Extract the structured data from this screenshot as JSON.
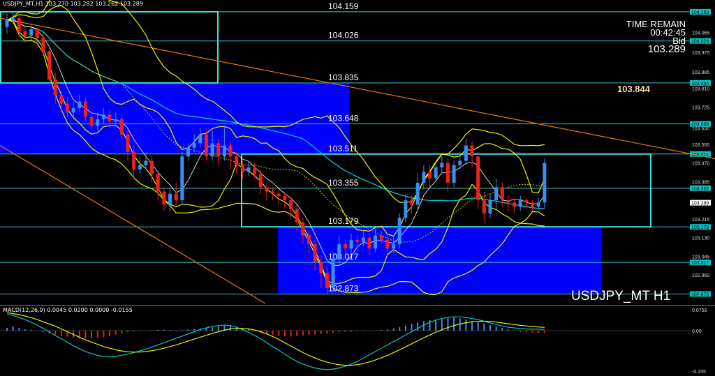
{
  "header": {
    "main_title": "USDJPY_MT,H1  103.270 103.282 103.262 103.289",
    "macd_title": "MACD(12,26,9) 0.0045 0.0200 0.0000 -0.0155"
  },
  "info": {
    "time_label": "TIME REMAIN",
    "time_value": "00:42:45",
    "bid_label": "Bid",
    "bid_value": "103.289"
  },
  "big_price": "103.844",
  "symbol_watermark": "USDJPY_MT H1",
  "colors": {
    "background": "#000000",
    "bull_candle": "#3a8df5",
    "bear_candle": "#f01e1e",
    "zone_fill": "#0000ff",
    "level_line": "#38c8c8",
    "box_outline": "#40e0e0",
    "bollinger": "#f0f000",
    "trendline": "#f07800",
    "ma_cyan": "#00c8c8",
    "ma_green": "#2e8b2e",
    "price_tag_bg": "#00c8c8",
    "current_tag_bg": "#ffffff"
  },
  "chart_data": {
    "type": "candlestick",
    "symbol": "USDJPY_MT",
    "timeframe": "H1",
    "ylim": [
      102.83,
      104.2
    ],
    "levels": [
      {
        "label": "104.159",
        "value": 104.159
      },
      {
        "label": "104.026",
        "value": 104.026
      },
      {
        "label": "103.835",
        "value": 103.835
      },
      {
        "label": "103.648",
        "value": 103.648
      },
      {
        "label": "103.511",
        "value": 103.511
      },
      {
        "label": "103.355",
        "value": 103.355
      },
      {
        "label": "103.179",
        "value": 103.179
      },
      {
        "label": "103.017",
        "value": 103.017
      },
      {
        "label": "102.873",
        "value": 102.873
      }
    ],
    "y_ticks": [
      "104.065",
      "103.975",
      "103.885",
      "103.810",
      "103.725",
      "103.630",
      "103.555",
      "103.470",
      "103.385",
      "103.289",
      "103.215",
      "103.130",
      "103.045",
      "102.960"
    ],
    "current_price": "103.289",
    "candles": [
      [
        104.09,
        104.12,
        104.15,
        104.06
      ],
      [
        104.12,
        104.13,
        104.16,
        104.1
      ],
      [
        104.13,
        104.07,
        104.14,
        104.04
      ],
      [
        104.07,
        104.05,
        104.1,
        104.02
      ],
      [
        104.05,
        104.08,
        104.1,
        104.03
      ],
      [
        104.08,
        104.04,
        104.09,
        104.02
      ],
      [
        104.04,
        103.98,
        104.06,
        103.96
      ],
      [
        103.98,
        103.85,
        104.0,
        103.82
      ],
      [
        103.85,
        103.78,
        103.88,
        103.74
      ],
      [
        103.78,
        103.74,
        103.8,
        103.71
      ],
      [
        103.74,
        103.7,
        103.77,
        103.68
      ],
      [
        103.7,
        103.72,
        103.75,
        103.67
      ],
      [
        103.72,
        103.75,
        103.78,
        103.7
      ],
      [
        103.75,
        103.68,
        103.77,
        103.66
      ],
      [
        103.68,
        103.64,
        103.7,
        103.62
      ],
      [
        103.64,
        103.67,
        103.7,
        103.62
      ],
      [
        103.67,
        103.69,
        103.72,
        103.65
      ],
      [
        103.69,
        103.66,
        103.71,
        103.63
      ],
      [
        103.66,
        103.67,
        103.7,
        103.64
      ],
      [
        103.67,
        103.6,
        103.69,
        103.58
      ],
      [
        103.6,
        103.52,
        103.62,
        103.48
      ],
      [
        103.52,
        103.44,
        103.55,
        103.4
      ],
      [
        103.44,
        103.46,
        103.5,
        103.42
      ],
      [
        103.46,
        103.48,
        103.52,
        103.44
      ],
      [
        103.48,
        103.42,
        103.5,
        103.38
      ],
      [
        103.42,
        103.34,
        103.44,
        103.3
      ],
      [
        103.34,
        103.28,
        103.36,
        103.25
      ],
      [
        103.28,
        103.33,
        103.36,
        103.25
      ],
      [
        103.33,
        103.3,
        103.38,
        103.28
      ],
      [
        103.3,
        103.5,
        103.52,
        103.28
      ],
      [
        103.5,
        103.54,
        103.56,
        103.48
      ],
      [
        103.54,
        103.56,
        103.6,
        103.52
      ],
      [
        103.56,
        103.6,
        103.63,
        103.54
      ],
      [
        103.6,
        103.5,
        103.62,
        103.48
      ],
      [
        103.5,
        103.56,
        103.62,
        103.48
      ],
      [
        103.56,
        103.5,
        103.58,
        103.46
      ],
      [
        103.5,
        103.55,
        103.64,
        103.48
      ],
      [
        103.55,
        103.5,
        103.57,
        103.44
      ],
      [
        103.5,
        103.46,
        103.52,
        103.42
      ],
      [
        103.46,
        103.43,
        103.48,
        103.4
      ],
      [
        103.43,
        103.45,
        103.48,
        103.41
      ],
      [
        103.45,
        103.42,
        103.47,
        103.4
      ],
      [
        103.42,
        103.36,
        103.44,
        103.33
      ],
      [
        103.36,
        103.34,
        103.38,
        103.3
      ],
      [
        103.34,
        103.33,
        103.36,
        103.3
      ],
      [
        103.33,
        103.32,
        103.35,
        103.28
      ],
      [
        103.32,
        103.3,
        103.34,
        103.26
      ],
      [
        103.3,
        103.26,
        103.32,
        103.22
      ],
      [
        103.26,
        103.2,
        103.28,
        103.16
      ],
      [
        103.2,
        103.14,
        103.22,
        103.1
      ],
      [
        103.14,
        103.1,
        103.16,
        103.06
      ],
      [
        103.1,
        103.02,
        103.12,
        102.98
      ],
      [
        103.02,
        102.97,
        103.05,
        102.9
      ],
      [
        102.97,
        102.9,
        103.0,
        102.87
      ],
      [
        102.9,
        103.03,
        103.06,
        102.88
      ],
      [
        103.03,
        103.1,
        103.14,
        103.0
      ],
      [
        103.1,
        103.08,
        103.12,
        103.05
      ],
      [
        103.08,
        103.12,
        103.15,
        103.06
      ],
      [
        103.12,
        103.11,
        103.14,
        103.07
      ],
      [
        103.11,
        103.13,
        103.16,
        103.09
      ],
      [
        103.13,
        103.08,
        103.15,
        103.05
      ],
      [
        103.08,
        103.14,
        103.17,
        103.06
      ],
      [
        103.14,
        103.12,
        103.16,
        103.1
      ],
      [
        103.12,
        103.08,
        103.14,
        103.05
      ],
      [
        103.08,
        103.1,
        103.13,
        103.06
      ],
      [
        103.1,
        103.22,
        103.24,
        103.08
      ],
      [
        103.22,
        103.3,
        103.33,
        103.2
      ],
      [
        103.3,
        103.28,
        103.32,
        103.24
      ],
      [
        103.28,
        103.38,
        103.42,
        103.26
      ],
      [
        103.38,
        103.43,
        103.46,
        103.35
      ],
      [
        103.43,
        103.4,
        103.46,
        103.36
      ],
      [
        103.4,
        103.45,
        103.48,
        103.38
      ],
      [
        103.45,
        103.47,
        103.5,
        103.42
      ],
      [
        103.47,
        103.38,
        103.49,
        103.34
      ],
      [
        103.38,
        103.46,
        103.48,
        103.36
      ],
      [
        103.46,
        103.48,
        103.52,
        103.44
      ],
      [
        103.48,
        103.55,
        103.58,
        103.46
      ],
      [
        103.55,
        103.5,
        103.57,
        103.45
      ],
      [
        103.5,
        103.3,
        103.52,
        103.26
      ],
      [
        103.3,
        103.24,
        103.34,
        103.2
      ],
      [
        103.24,
        103.3,
        103.33,
        103.22
      ],
      [
        103.3,
        103.36,
        103.4,
        103.26
      ],
      [
        103.36,
        103.3,
        103.38,
        103.27
      ],
      [
        103.3,
        103.29,
        103.32,
        103.25
      ],
      [
        103.29,
        103.27,
        103.31,
        103.24
      ],
      [
        103.27,
        103.3,
        103.32,
        103.25
      ],
      [
        103.3,
        103.29,
        103.31,
        103.26
      ],
      [
        103.29,
        103.27,
        103.3,
        103.25
      ],
      [
        103.27,
        103.29,
        103.31,
        103.26
      ],
      [
        103.29,
        103.47,
        103.49,
        103.26
      ]
    ],
    "macd_ylim": [
      -0.155,
      0.0759
    ],
    "macd_ticks": [
      "0.0759",
      "0.00",
      "-0.155"
    ],
    "macd_hist": [
      0.01,
      0.015,
      0.01,
      0.005,
      0.003,
      0.0,
      -0.005,
      -0.01,
      -0.015,
      -0.02,
      -0.022,
      -0.025,
      -0.028,
      -0.03,
      -0.028,
      -0.026,
      -0.024,
      -0.02,
      -0.015,
      -0.01,
      -0.005,
      -0.003,
      -0.002,
      0.0,
      0.002,
      0.003,
      0.003,
      0.002,
      0.001,
      0.002,
      0.004,
      0.006,
      0.008,
      0.01,
      0.012,
      0.015,
      0.018,
      0.02,
      0.015,
      0.01,
      0.005,
      -0.003,
      -0.008,
      -0.012,
      -0.015,
      -0.018,
      -0.02,
      -0.022,
      -0.02,
      -0.018,
      -0.016,
      -0.014,
      -0.012,
      -0.01,
      -0.008,
      -0.006,
      -0.005,
      -0.004,
      -0.003,
      -0.002,
      -0.001,
      0.0,
      0.002,
      0.004,
      0.008,
      0.012,
      0.018,
      0.025,
      0.03,
      0.035,
      0.038,
      0.04,
      0.042,
      0.045,
      0.048,
      0.045,
      0.04,
      0.035,
      0.03,
      0.025,
      0.02,
      0.015,
      0.01,
      0.005,
      0.0,
      -0.005,
      -0.006,
      -0.007,
      -0.008,
      -0.008
    ],
    "macd_line": [
      0.06,
      0.055,
      0.048,
      0.04,
      0.03,
      0.02,
      0.008,
      -0.005,
      -0.018,
      -0.03,
      -0.042,
      -0.055,
      -0.066,
      -0.076,
      -0.084,
      -0.09,
      -0.094,
      -0.096,
      -0.094,
      -0.09,
      -0.085,
      -0.08,
      -0.074,
      -0.068,
      -0.06,
      -0.052,
      -0.044,
      -0.036,
      -0.028,
      -0.02,
      -0.012,
      -0.004,
      0.004,
      0.01,
      0.015,
      0.018,
      0.02,
      0.018,
      0.012,
      0.004,
      -0.006,
      -0.018,
      -0.03,
      -0.044,
      -0.058,
      -0.072,
      -0.086,
      -0.1,
      -0.112,
      -0.122,
      -0.13,
      -0.136,
      -0.14,
      -0.142,
      -0.14,
      -0.136,
      -0.13,
      -0.122,
      -0.112,
      -0.1,
      -0.088,
      -0.076,
      -0.064,
      -0.052,
      -0.04,
      -0.028,
      -0.016,
      -0.004,
      0.008,
      0.02,
      0.03,
      0.038,
      0.044,
      0.048,
      0.05,
      0.05,
      0.048,
      0.044,
      0.04,
      0.034,
      0.028,
      0.022,
      0.016,
      0.012,
      0.01,
      0.008,
      0.006,
      0.005,
      0.005,
      0.004
    ],
    "signal_line": [
      0.065,
      0.062,
      0.058,
      0.053,
      0.047,
      0.04,
      0.032,
      0.024,
      0.016,
      0.006,
      -0.004,
      -0.014,
      -0.024,
      -0.034,
      -0.042,
      -0.05,
      -0.058,
      -0.064,
      -0.07,
      -0.074,
      -0.077,
      -0.078,
      -0.078,
      -0.076,
      -0.073,
      -0.069,
      -0.064,
      -0.058,
      -0.052,
      -0.045,
      -0.038,
      -0.031,
      -0.024,
      -0.017,
      -0.01,
      -0.004,
      0.002,
      0.006,
      0.008,
      0.008,
      0.006,
      0.002,
      -0.004,
      -0.012,
      -0.022,
      -0.032,
      -0.044,
      -0.056,
      -0.068,
      -0.08,
      -0.09,
      -0.1,
      -0.108,
      -0.115,
      -0.12,
      -0.124,
      -0.126,
      -0.126,
      -0.124,
      -0.12,
      -0.114,
      -0.107,
      -0.099,
      -0.09,
      -0.08,
      -0.07,
      -0.059,
      -0.048,
      -0.037,
      -0.026,
      -0.016,
      -0.006,
      0.003,
      0.011,
      0.018,
      0.024,
      0.029,
      0.032,
      0.034,
      0.034,
      0.033,
      0.031,
      0.028,
      0.025,
      0.022,
      0.019,
      0.017,
      0.015,
      0.013,
      0.012
    ]
  }
}
